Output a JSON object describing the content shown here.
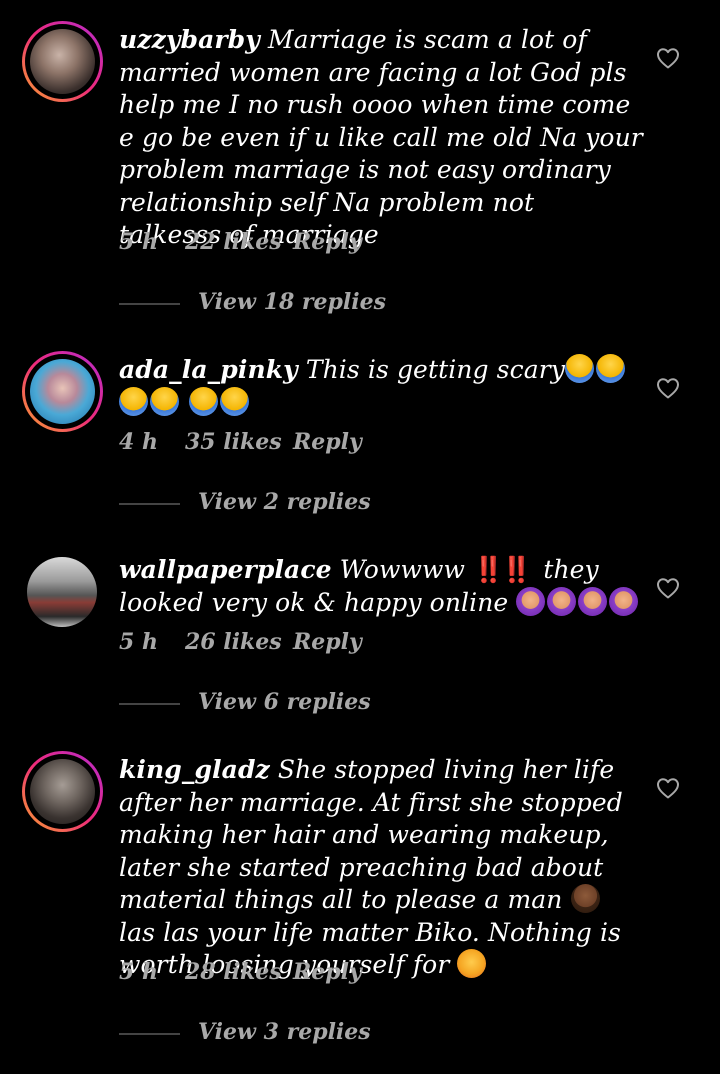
{
  "comments": [
    {
      "username": "uzzybarby",
      "text": "Marriage is scam a lot of married women are facing a lot God pls help me  I no rush oooo  when time come e go be even if u like call me old Na your problem marriage is not easy ordinary relationship self Na problem not talkesss of marriage",
      "time": "5 h",
      "likes": "22 likes",
      "reply": "Reply",
      "view_replies": "View 18 replies"
    },
    {
      "username": "ada_la_pinky",
      "text": "This is getting scary",
      "emojis": [
        "fearful-face",
        "fearful-face",
        "fearful-face",
        "fearful-face",
        "fearful-face",
        "fearful-face"
      ],
      "time": "4 h",
      "likes": "35 likes",
      "reply": "Reply",
      "view_replies": "View 2 replies"
    },
    {
      "username": "wallpaperplace",
      "text_before": "Wowwww",
      "bangs": "‼️‼️",
      "text_after": "they looked very ok & happy online",
      "emojis": [
        "woman-gesturing-ok",
        "woman-gesturing-ok",
        "woman-gesturing-ok",
        "woman-gesturing-ok"
      ],
      "time": "5 h",
      "likes": "26 likes",
      "reply": "Reply",
      "view_replies": "View 6 replies"
    },
    {
      "username": "king_gladz",
      "text_part1": "She stopped living her life after her marriage. At first she stopped making her hair and wearing makeup, later she started preaching bad about material things all to please a man",
      "text_part2": "las las your life matter Biko. Nothing is worth loosing yourself for",
      "emojis": [
        "woman-facepalming",
        "person-shrugging"
      ],
      "time": "5 h",
      "likes": "28 likes",
      "reply": "Reply",
      "view_replies": "View 3 replies"
    }
  ],
  "colors": {
    "background": "#000000",
    "text": "#ffffff",
    "meta": "#a8a8a8",
    "story_ring_start": "#f9a12e",
    "story_ring_end": "#b32bd1"
  }
}
